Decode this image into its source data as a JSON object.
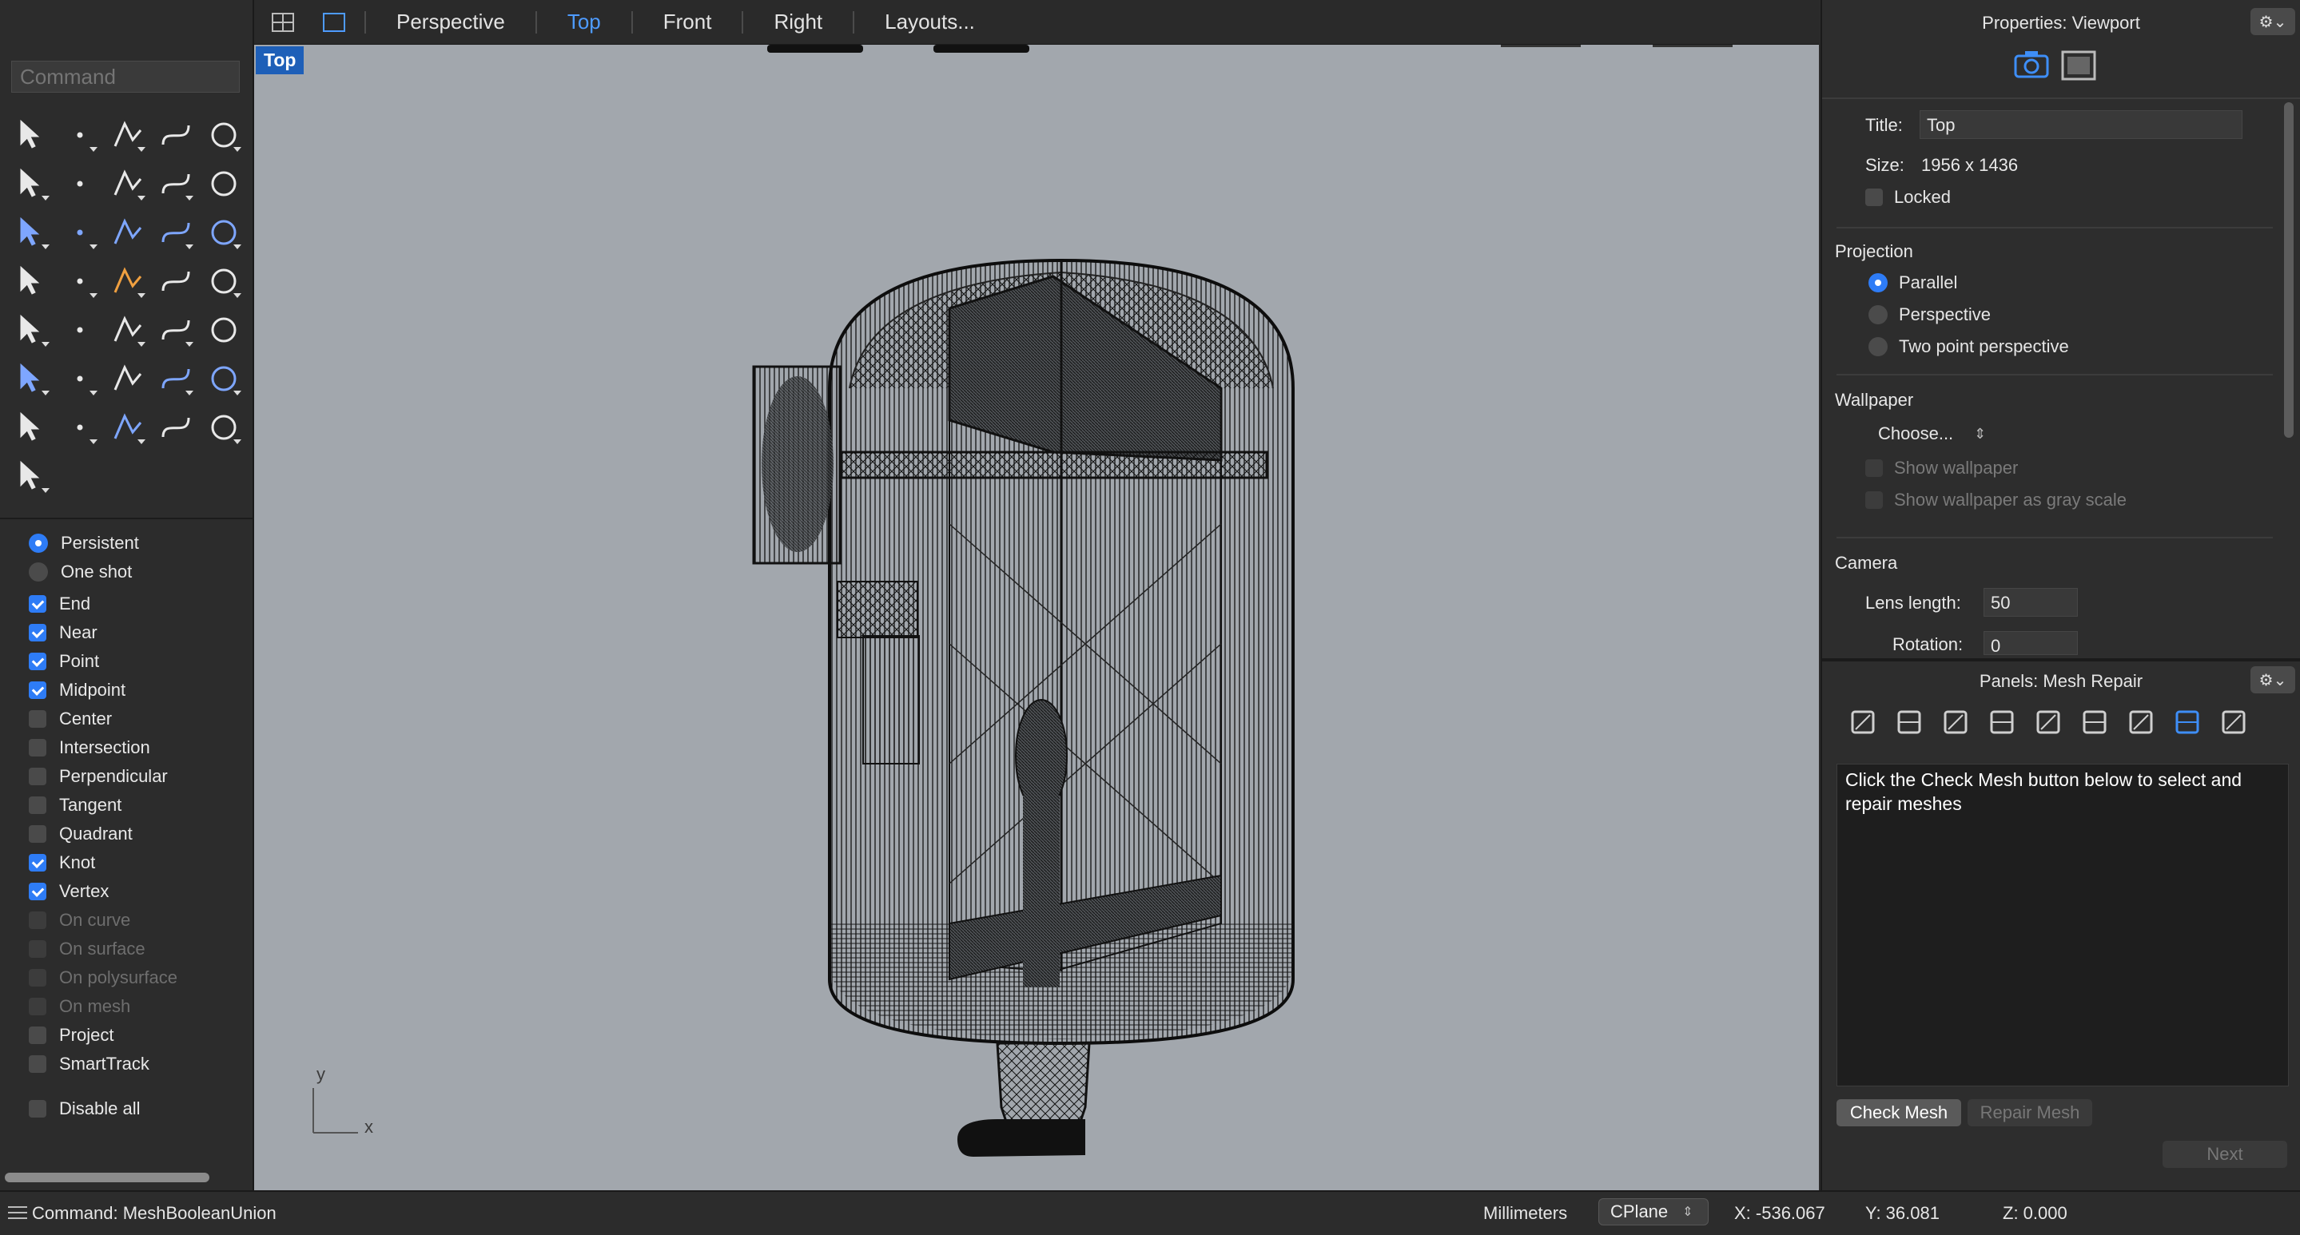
{
  "command_prompt": {
    "placeholder": "Command"
  },
  "toolbar_icons": [
    "select-arrow-icon",
    "point-icon",
    "polyline-icon",
    "curve-icon",
    "circle-icon",
    "ellipse-icon",
    "polygon-icon",
    "rectangle-icon",
    "arc-icon",
    "fillet-icon",
    "surface-icon",
    "extrude-icon",
    "box-icon",
    "sphere-icon",
    "cylinder-icon",
    "plane-icon",
    "explode-icon",
    "split-icon",
    "trim-icon",
    "join-icon",
    "boolean-union-icon",
    "group-icon",
    "curve-blend-icon",
    "offset-icon",
    "text-icon",
    "move-icon",
    "array-icon",
    "scale-icon",
    "mesh-box-icon",
    "dimension-icon",
    "grid-icon",
    "ruler-icon",
    "drape-icon",
    "checkmark-icon",
    "render-icon",
    "paint-icon"
  ],
  "osnap": {
    "mode_options": [
      {
        "label": "Persistent",
        "selected": true
      },
      {
        "label": "One shot",
        "selected": false
      }
    ],
    "items": [
      {
        "label": "End",
        "checked": true,
        "enabled": true
      },
      {
        "label": "Near",
        "checked": true,
        "enabled": true
      },
      {
        "label": "Point",
        "checked": true,
        "enabled": true
      },
      {
        "label": "Midpoint",
        "checked": true,
        "enabled": true
      },
      {
        "label": "Center",
        "checked": false,
        "enabled": true
      },
      {
        "label": "Intersection",
        "checked": false,
        "enabled": true
      },
      {
        "label": "Perpendicular",
        "checked": false,
        "enabled": true
      },
      {
        "label": "Tangent",
        "checked": false,
        "enabled": true
      },
      {
        "label": "Quadrant",
        "checked": false,
        "enabled": true
      },
      {
        "label": "Knot",
        "checked": true,
        "enabled": true
      },
      {
        "label": "Vertex",
        "checked": true,
        "enabled": true
      },
      {
        "label": "On curve",
        "checked": false,
        "enabled": false
      },
      {
        "label": "On surface",
        "checked": false,
        "enabled": false
      },
      {
        "label": "On polysurface",
        "checked": false,
        "enabled": false
      },
      {
        "label": "On mesh",
        "checked": false,
        "enabled": false
      },
      {
        "label": "Project",
        "checked": false,
        "enabled": true
      },
      {
        "label": "SmartTrack",
        "checked": false,
        "enabled": true
      }
    ],
    "disable_all": "Disable all"
  },
  "viewport_tabs": [
    "Perspective",
    "Top",
    "Front",
    "Right",
    "Layouts..."
  ],
  "active_tab": "Top",
  "viewport": {
    "label": "Top",
    "axis_y": "y",
    "axis_x": "x"
  },
  "properties": {
    "title": "Properties: Viewport",
    "title_label": "Title:",
    "title_value": "Top",
    "size_label": "Size:",
    "size_value": "1956 x 1436",
    "locked_label": "Locked",
    "projection_title": "Projection",
    "projection_options": [
      {
        "label": "Parallel",
        "selected": true
      },
      {
        "label": "Perspective",
        "selected": false
      },
      {
        "label": "Two point perspective",
        "selected": false
      }
    ],
    "wallpaper_title": "Wallpaper",
    "wallpaper_choose": "Choose...",
    "show_wallpaper": "Show wallpaper",
    "show_wallpaper_gray": "Show wallpaper as gray scale",
    "camera_title": "Camera",
    "lens_label": "Lens length:",
    "lens_value": "50",
    "rotation_label": "Rotation:",
    "rotation_value": "0"
  },
  "mesh_repair": {
    "title": "Panels: Mesh Repair",
    "panel_icons": [
      "layers-icon",
      "materials-icon",
      "document-icon",
      "object-icon",
      "notes-icon",
      "display-icon",
      "help-icon",
      "mesh-repair-icon",
      "sheet-icon"
    ],
    "message": "Click the Check Mesh button below to select and repair meshes",
    "check_button": "Check Mesh",
    "repair_button": "Repair Mesh",
    "next_button": "Next"
  },
  "status": {
    "command": "Command: MeshBooleanUnion",
    "units": "Millimeters",
    "cplane": "CPlane",
    "x": "X: -536.067",
    "y": "Y: 36.081",
    "z": "Z: 0.000"
  },
  "colors": {
    "accent": "#2e7cf6",
    "viewport_bg": "#a2a7ad",
    "active_tab": "#4e9bff",
    "viewport_label": "#1e5fb8"
  }
}
